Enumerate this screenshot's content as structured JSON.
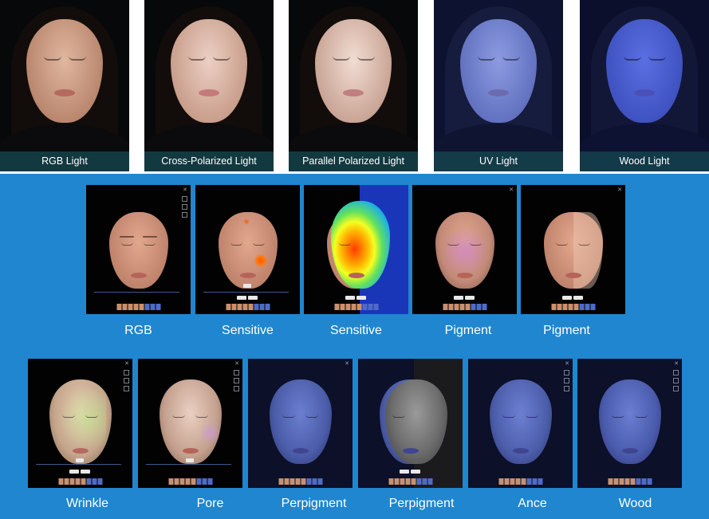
{
  "top_row": [
    {
      "label": "RGB Light",
      "skin": "#c9a08a",
      "bg_tint": "#07080a"
    },
    {
      "label": "Cross-Polarized Light",
      "skin": "#d6b1a1",
      "bg_tint": "#0a0a0b"
    },
    {
      "label": "Parallel Polarized Light",
      "skin": "#d2b3a6",
      "bg_tint": "#0b0b0c"
    },
    {
      "label": "UV Light",
      "skin": "#6f7fc6",
      "bg_tint": "#141a36"
    },
    {
      "label": "Wood Light",
      "skin": "#4a5fd0",
      "bg_tint": "#10143a"
    }
  ],
  "row2": [
    {
      "caption": "RGB",
      "mode": "rgb"
    },
    {
      "caption": "Sensitive",
      "mode": "sensitive"
    },
    {
      "caption": "Sensitive",
      "mode": "sensitive-heatmap"
    },
    {
      "caption": "Pigment",
      "mode": "pigment"
    },
    {
      "caption": "Pigment",
      "mode": "pigment-split"
    }
  ],
  "row3": [
    {
      "caption": "Wrinkle",
      "mode": "wrinkle"
    },
    {
      "caption": "Pore",
      "mode": "pore"
    },
    {
      "caption": "Perpigment",
      "mode": "perpigment"
    },
    {
      "caption": "Perpigment",
      "mode": "perpigment-split"
    },
    {
      "caption": "Ance",
      "mode": "ance"
    },
    {
      "caption": "Wood",
      "mode": "wood"
    }
  ],
  "colors": {
    "panel_blue": "#1f86cf",
    "label_bar": "#164650",
    "warm_skin": "#c8917a",
    "uv_skin": "#4b5fae"
  }
}
